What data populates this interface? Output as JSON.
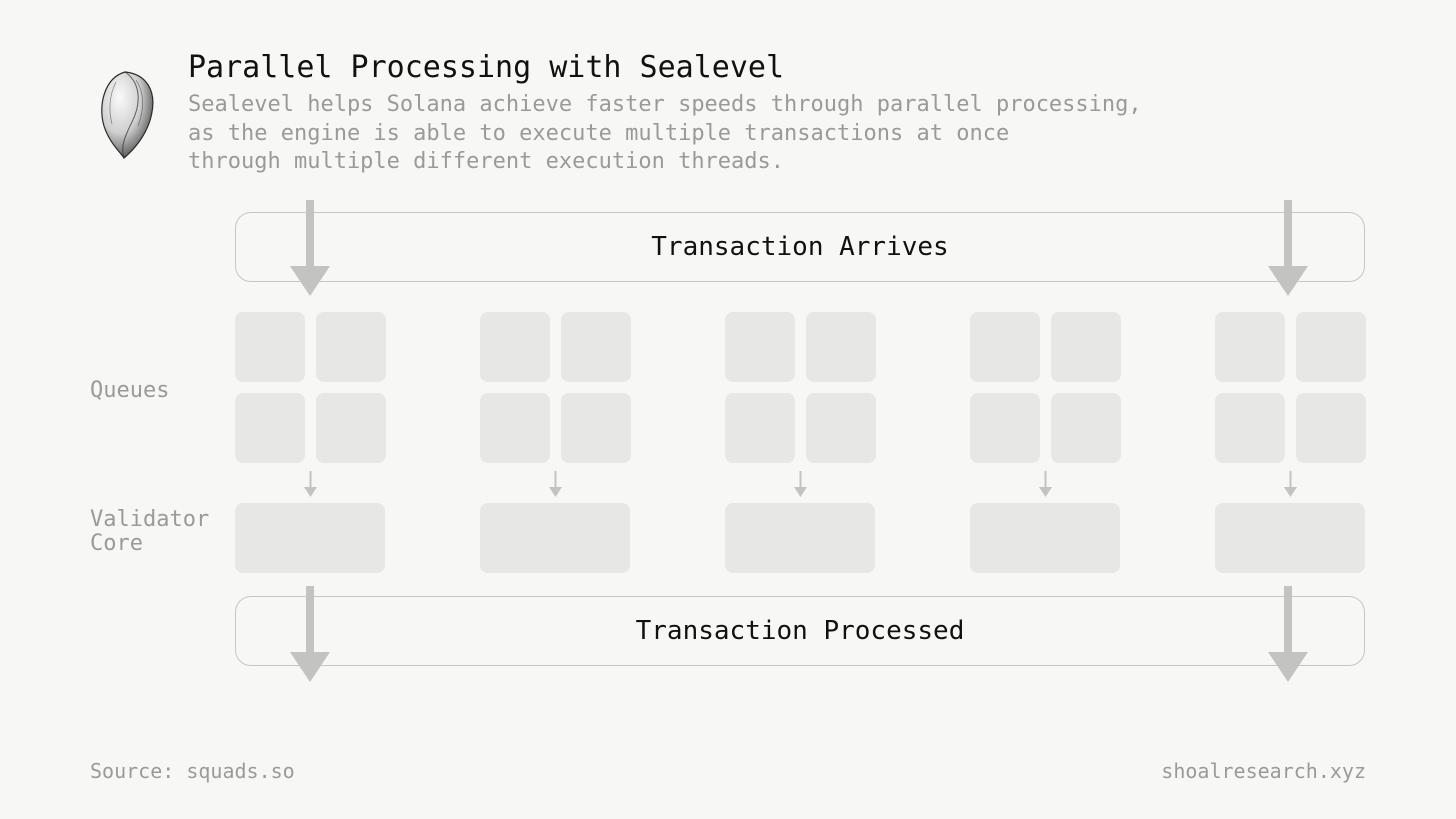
{
  "title": "Parallel Processing with Sealevel",
  "subtitle": "Sealevel helps Solana achieve faster speeds through parallel processing,\nas the engine is able to execute multiple transactions at once\nthrough multiple different execution threads.",
  "icon": "shell-icon",
  "stage_arrives_label": "Transaction Arrives",
  "stage_processed_label": "Transaction Processed",
  "row_labels": {
    "queues": "Queues",
    "validator_core": "Validator\nCore"
  },
  "n_columns": 5,
  "source_label": "Source: squads.so",
  "brand": "shoalresearch.xyz",
  "colors": {
    "bg": "#f7f7f5",
    "block": "#e7e7e5",
    "border": "#c6c6c4",
    "text_muted": "#9a9a9a",
    "arrow": "#c3c3c1"
  }
}
